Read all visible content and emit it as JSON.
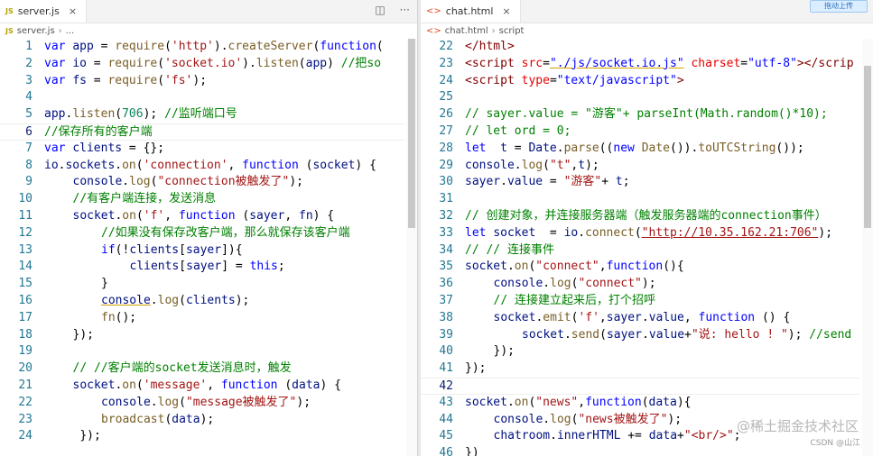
{
  "left": {
    "tab": {
      "badge": "JS",
      "filename": "server.js",
      "close": "×"
    },
    "breadcrumb": {
      "file": "server.js",
      "rest": "..."
    },
    "actions": {
      "split": "◫",
      "more": "···"
    },
    "lines": [
      {
        "n": "1",
        "tokens": [
          [
            "kw",
            "var "
          ],
          [
            "var",
            "app"
          ],
          [
            "plain",
            " = "
          ],
          [
            "fn",
            "require"
          ],
          [
            "plain",
            "("
          ],
          [
            "str",
            "'http'"
          ],
          [
            "plain",
            ")."
          ],
          [
            "fn",
            "createServer"
          ],
          [
            "plain",
            "("
          ],
          [
            "kw",
            "function"
          ],
          [
            "plain",
            "("
          ]
        ]
      },
      {
        "n": "2",
        "tokens": [
          [
            "kw",
            "var "
          ],
          [
            "var",
            "io"
          ],
          [
            "plain",
            " = "
          ],
          [
            "fn",
            "require"
          ],
          [
            "plain",
            "("
          ],
          [
            "str",
            "'socket.io'"
          ],
          [
            "plain",
            ")."
          ],
          [
            "fn",
            "listen"
          ],
          [
            "plain",
            "("
          ],
          [
            "var",
            "app"
          ],
          [
            "plain",
            ") "
          ],
          [
            "cmt",
            "//把so"
          ]
        ]
      },
      {
        "n": "3",
        "tokens": [
          [
            "kw",
            "var "
          ],
          [
            "var",
            "fs"
          ],
          [
            "plain",
            " = "
          ],
          [
            "fn",
            "require"
          ],
          [
            "plain",
            "("
          ],
          [
            "str",
            "'fs'"
          ],
          [
            "plain",
            ");"
          ]
        ]
      },
      {
        "n": "4",
        "tokens": []
      },
      {
        "n": "5",
        "tokens": [
          [
            "var",
            "app"
          ],
          [
            "plain",
            "."
          ],
          [
            "fn",
            "listen"
          ],
          [
            "plain",
            "("
          ],
          [
            "num",
            "706"
          ],
          [
            "plain",
            "); "
          ],
          [
            "cmt",
            "//监听端口号"
          ]
        ]
      },
      {
        "n": "6",
        "cur": true,
        "tokens": [
          [
            "cmt",
            "//保存所有的客户端"
          ]
        ]
      },
      {
        "n": "7",
        "tokens": [
          [
            "kw",
            "var "
          ],
          [
            "var",
            "clients"
          ],
          [
            "plain",
            " = {};"
          ]
        ]
      },
      {
        "n": "8",
        "tokens": [
          [
            "var",
            "io"
          ],
          [
            "plain",
            "."
          ],
          [
            "var",
            "sockets"
          ],
          [
            "plain",
            "."
          ],
          [
            "fn",
            "on"
          ],
          [
            "plain",
            "("
          ],
          [
            "str",
            "'connection'"
          ],
          [
            "plain",
            ", "
          ],
          [
            "kw",
            "function"
          ],
          [
            "plain",
            " ("
          ],
          [
            "var",
            "socket"
          ],
          [
            "plain",
            ") {"
          ]
        ]
      },
      {
        "n": "9",
        "indent": 1,
        "tokens": [
          [
            "var",
            "console"
          ],
          [
            "plain",
            "."
          ],
          [
            "fn",
            "log"
          ],
          [
            "plain",
            "("
          ],
          [
            "str",
            "\"connection被触发了\""
          ],
          [
            "plain",
            ");"
          ]
        ]
      },
      {
        "n": "10",
        "indent": 1,
        "tokens": [
          [
            "cmt",
            "//有客户端连接，发送消息"
          ]
        ]
      },
      {
        "n": "11",
        "indent": 1,
        "tokens": [
          [
            "var",
            "socket"
          ],
          [
            "plain",
            "."
          ],
          [
            "fn",
            "on"
          ],
          [
            "plain",
            "("
          ],
          [
            "str",
            "'f'"
          ],
          [
            "plain",
            ", "
          ],
          [
            "kw",
            "function"
          ],
          [
            "plain",
            " ("
          ],
          [
            "var",
            "sayer"
          ],
          [
            "plain",
            ", "
          ],
          [
            "var",
            "fn"
          ],
          [
            "plain",
            ") {"
          ]
        ]
      },
      {
        "n": "12",
        "indent": 2,
        "tokens": [
          [
            "cmt",
            "//如果没有保存改客户端，那么就保存该客户端"
          ]
        ]
      },
      {
        "n": "13",
        "indent": 2,
        "tokens": [
          [
            "kw",
            "if"
          ],
          [
            "plain",
            "(!"
          ],
          [
            "var",
            "clients"
          ],
          [
            "plain",
            "["
          ],
          [
            "var",
            "sayer"
          ],
          [
            "plain",
            "]){"
          ]
        ]
      },
      {
        "n": "14",
        "indent": 3,
        "tokens": [
          [
            "var",
            "clients"
          ],
          [
            "plain",
            "["
          ],
          [
            "var",
            "sayer"
          ],
          [
            "plain",
            "] = "
          ],
          [
            "kw",
            "this"
          ],
          [
            "plain",
            ";"
          ]
        ]
      },
      {
        "n": "15",
        "indent": 2,
        "tokens": [
          [
            "plain",
            "}"
          ]
        ]
      },
      {
        "n": "16",
        "indent": 2,
        "tokens": [
          [
            "var ul",
            "console"
          ],
          [
            "plain",
            "."
          ],
          [
            "fn",
            "log"
          ],
          [
            "plain",
            "("
          ],
          [
            "var",
            "clients"
          ],
          [
            "plain",
            ");"
          ]
        ]
      },
      {
        "n": "17",
        "indent": 2,
        "tokens": [
          [
            "fn",
            "fn"
          ],
          [
            "plain",
            "();"
          ]
        ]
      },
      {
        "n": "18",
        "indent": 1,
        "tokens": [
          [
            "plain",
            "});"
          ]
        ]
      },
      {
        "n": "19",
        "tokens": []
      },
      {
        "n": "20",
        "indent": 1,
        "tokens": [
          [
            "cmt",
            "// //客户端的socket发送消息时，触发"
          ]
        ]
      },
      {
        "n": "21",
        "indent": 1,
        "tokens": [
          [
            "var",
            "socket"
          ],
          [
            "plain",
            "."
          ],
          [
            "fn",
            "on"
          ],
          [
            "plain",
            "("
          ],
          [
            "str",
            "'message'"
          ],
          [
            "plain",
            ", "
          ],
          [
            "kw",
            "function"
          ],
          [
            "plain",
            " ("
          ],
          [
            "var",
            "data"
          ],
          [
            "plain",
            ") {"
          ]
        ]
      },
      {
        "n": "22",
        "indent": 2,
        "tokens": [
          [
            "var",
            "console"
          ],
          [
            "plain",
            "."
          ],
          [
            "fn",
            "log"
          ],
          [
            "plain",
            "("
          ],
          [
            "str",
            "\"message被触发了\""
          ],
          [
            "plain",
            ");"
          ]
        ]
      },
      {
        "n": "23",
        "indent": 2,
        "tokens": [
          [
            "fn",
            "broadcast"
          ],
          [
            "plain",
            "("
          ],
          [
            "var",
            "data"
          ],
          [
            "plain",
            ");"
          ]
        ]
      },
      {
        "n": "24",
        "indent": 1,
        "tokens": [
          [
            "plain",
            " });"
          ]
        ]
      }
    ]
  },
  "right": {
    "tab": {
      "filename": "chat.html",
      "close": "×"
    },
    "breadcrumb": {
      "file": "chat.html",
      "rest": "script"
    },
    "float_button": "拖动上传",
    "lines": [
      {
        "n": "22",
        "tokens": [
          [
            "tag",
            "</html>"
          ]
        ]
      },
      {
        "n": "23",
        "tokens": [
          [
            "tag",
            "<script "
          ],
          [
            "attr",
            "src"
          ],
          [
            "plain",
            "="
          ],
          [
            "attv ul",
            "\"./js/socket.io.js\""
          ],
          [
            "plain",
            " "
          ],
          [
            "attr",
            "charset"
          ],
          [
            "plain",
            "="
          ],
          [
            "attv",
            "\"utf-8\""
          ],
          [
            "tag",
            "></scrip"
          ]
        ]
      },
      {
        "n": "24",
        "tokens": [
          [
            "tag",
            "<script "
          ],
          [
            "attr",
            "type"
          ],
          [
            "plain",
            "="
          ],
          [
            "attv",
            "\"text/javascript\""
          ],
          [
            "tag",
            ">"
          ]
        ]
      },
      {
        "n": "25",
        "tokens": []
      },
      {
        "n": "26",
        "tokens": [
          [
            "cmt",
            "// sayer.value = \"游客\"+ parseInt(Math.random()*10);"
          ]
        ]
      },
      {
        "n": "27",
        "tokens": [
          [
            "cmt",
            "// let ord = 0;"
          ]
        ]
      },
      {
        "n": "28",
        "tokens": [
          [
            "kw",
            "let "
          ],
          [
            "var",
            " t"
          ],
          [
            "plain",
            " = "
          ],
          [
            "var",
            "Date"
          ],
          [
            "plain",
            "."
          ],
          [
            "fn",
            "parse"
          ],
          [
            "plain",
            "(("
          ],
          [
            "kw",
            "new "
          ],
          [
            "fn",
            "Date"
          ],
          [
            "plain",
            "())."
          ],
          [
            "fn",
            "toUTCString"
          ],
          [
            "plain",
            "());"
          ]
        ]
      },
      {
        "n": "29",
        "tokens": [
          [
            "var",
            "console"
          ],
          [
            "plain",
            "."
          ],
          [
            "fn",
            "log"
          ],
          [
            "plain",
            "("
          ],
          [
            "str",
            "\"t\""
          ],
          [
            "plain",
            ","
          ],
          [
            "var",
            "t"
          ],
          [
            "plain",
            ");"
          ]
        ]
      },
      {
        "n": "30",
        "tokens": [
          [
            "var",
            "sayer"
          ],
          [
            "plain",
            "."
          ],
          [
            "var",
            "value"
          ],
          [
            "plain",
            " = "
          ],
          [
            "str",
            "\"游客\""
          ],
          [
            "plain",
            "+ "
          ],
          [
            "var",
            "t"
          ],
          [
            "plain",
            ";"
          ]
        ]
      },
      {
        "n": "31",
        "tokens": []
      },
      {
        "n": "32",
        "tokens": [
          [
            "cmt",
            "// 创建对象，并连接服务器端（触发服务器端的connection事件）"
          ]
        ]
      },
      {
        "n": "33",
        "tokens": [
          [
            "kw",
            "let "
          ],
          [
            "var",
            "socket"
          ],
          [
            "plain",
            "  = "
          ],
          [
            "var",
            "io"
          ],
          [
            "plain",
            "."
          ],
          [
            "fn",
            "connect"
          ],
          [
            "plain",
            "("
          ],
          [
            "str link",
            "\"http://10.35.162.21:706\""
          ],
          [
            "plain",
            ");"
          ]
        ]
      },
      {
        "n": "34",
        "tokens": [
          [
            "cmt",
            "// // 连接事件"
          ]
        ]
      },
      {
        "n": "35",
        "tokens": [
          [
            "var",
            "socket"
          ],
          [
            "plain",
            "."
          ],
          [
            "fn",
            "on"
          ],
          [
            "plain",
            "("
          ],
          [
            "str",
            "\"connect\""
          ],
          [
            "plain",
            ","
          ],
          [
            "kw",
            "function"
          ],
          [
            "plain",
            "(){"
          ]
        ]
      },
      {
        "n": "36",
        "indent": 1,
        "tokens": [
          [
            "var",
            "console"
          ],
          [
            "plain",
            "."
          ],
          [
            "fn",
            "log"
          ],
          [
            "plain",
            "("
          ],
          [
            "str",
            "\"connect\""
          ],
          [
            "plain",
            ");"
          ]
        ]
      },
      {
        "n": "37",
        "indent": 1,
        "tokens": [
          [
            "cmt",
            "// 连接建立起来后，打个招呼"
          ]
        ]
      },
      {
        "n": "38",
        "indent": 1,
        "tokens": [
          [
            "var",
            "socket"
          ],
          [
            "plain",
            "."
          ],
          [
            "fn",
            "emit"
          ],
          [
            "plain",
            "("
          ],
          [
            "str",
            "'f'"
          ],
          [
            "plain",
            ","
          ],
          [
            "var",
            "sayer"
          ],
          [
            "plain",
            "."
          ],
          [
            "var",
            "value"
          ],
          [
            "plain",
            ", "
          ],
          [
            "kw",
            "function"
          ],
          [
            "plain",
            " () {"
          ]
        ]
      },
      {
        "n": "39",
        "indent": 2,
        "tokens": [
          [
            "var",
            "socket"
          ],
          [
            "plain",
            "."
          ],
          [
            "fn",
            "send"
          ],
          [
            "plain",
            "("
          ],
          [
            "var",
            "sayer"
          ],
          [
            "plain",
            "."
          ],
          [
            "var",
            "value"
          ],
          [
            "plain",
            "+"
          ],
          [
            "str",
            "\"说: hello ! \""
          ],
          [
            "plain",
            "); "
          ],
          [
            "cmt",
            "//send"
          ]
        ]
      },
      {
        "n": "40",
        "indent": 1,
        "tokens": [
          [
            "plain",
            "});"
          ]
        ]
      },
      {
        "n": "41",
        "tokens": [
          [
            "plain",
            "});"
          ]
        ]
      },
      {
        "n": "42",
        "cur": true,
        "tokens": []
      },
      {
        "n": "43",
        "tokens": [
          [
            "var",
            "socket"
          ],
          [
            "plain",
            "."
          ],
          [
            "fn",
            "on"
          ],
          [
            "plain",
            "("
          ],
          [
            "str",
            "\"news\""
          ],
          [
            "plain",
            ","
          ],
          [
            "kw",
            "function"
          ],
          [
            "plain",
            "("
          ],
          [
            "var",
            "data"
          ],
          [
            "plain",
            "){"
          ]
        ]
      },
      {
        "n": "44",
        "indent": 1,
        "tokens": [
          [
            "var",
            "console"
          ],
          [
            "plain",
            "."
          ],
          [
            "fn",
            "log"
          ],
          [
            "plain",
            "("
          ],
          [
            "str",
            "\"news被触发了\""
          ],
          [
            "plain",
            ");"
          ]
        ]
      },
      {
        "n": "45",
        "indent": 1,
        "tokens": [
          [
            "var",
            "chatroom"
          ],
          [
            "plain",
            "."
          ],
          [
            "var",
            "innerHTML"
          ],
          [
            "plain",
            " += "
          ],
          [
            "var",
            "data"
          ],
          [
            "plain",
            "+"
          ],
          [
            "str",
            "\"<br/>\""
          ],
          [
            "plain",
            ";"
          ]
        ]
      },
      {
        "n": "46",
        "tokens": [
          [
            "plain",
            "})"
          ]
        ]
      }
    ]
  },
  "watermark": {
    "main": "@稀土掘金技术社区",
    "sub": "CSDN @山江"
  }
}
